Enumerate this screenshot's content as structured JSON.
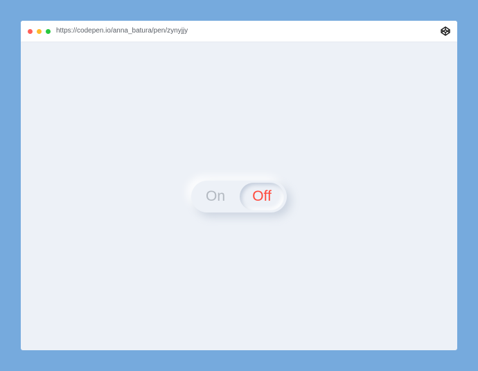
{
  "browser": {
    "url": "https://codepen.io/anna_batura/pen/zynyjjy",
    "window_dots": [
      "close",
      "minimize",
      "maximize"
    ],
    "logo_icon": "codepen-icon"
  },
  "toggle": {
    "on_label": "On",
    "off_label": "Off",
    "selected": "Off"
  },
  "colors": {
    "page_background": "#76aadd",
    "window_background": "#edf1f7",
    "dot_close": "#ff5f57",
    "dot_minimize": "#febc2e",
    "dot_maximize": "#28c840",
    "toggle_inactive_text": "#b3b9c1",
    "toggle_active_text": "#ff4a3d"
  }
}
